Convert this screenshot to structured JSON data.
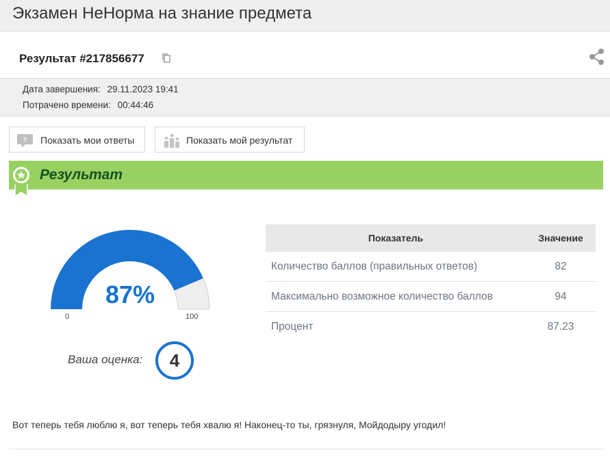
{
  "header": {
    "title": "Экзамен НеНорма на знание предмета"
  },
  "result": {
    "title": "Результат #217856677",
    "copy_icon": "copy-icon",
    "share_icon": "share-icon"
  },
  "meta": {
    "completion_label": "Дата завершения:",
    "completion_value": "29.11.2023 19:41",
    "time_label": "Потрачено времени:",
    "time_value": "00:44:46"
  },
  "buttons": {
    "show_answers": "Показать мои ответы",
    "show_result": "Показать мой результат"
  },
  "section": {
    "title": "Результат"
  },
  "gauge": {
    "percent_text": "87%",
    "value": 87.23,
    "min": "0",
    "max": "100",
    "fill_color": "#1a73d1",
    "rest_color": "#eeeeee"
  },
  "grade": {
    "label": "Ваша оценка:",
    "value": "4"
  },
  "table": {
    "headers": [
      "Показатель",
      "Значение"
    ],
    "rows": [
      {
        "name": "Количество баллов (правильных ответов)",
        "value": "82"
      },
      {
        "name": "Максимально возможное количество баллов",
        "value": "94"
      },
      {
        "name": "Процент",
        "value": "87.23"
      }
    ]
  },
  "message": "Вот теперь тебя люблю я, вот теперь тебя хвалю я! Наконец-то ты, грязнуля, Мойдодыру угодил!",
  "colors": {
    "accent": "#1a73d1",
    "banner": "#98d161",
    "banner_text": "#18521f"
  }
}
